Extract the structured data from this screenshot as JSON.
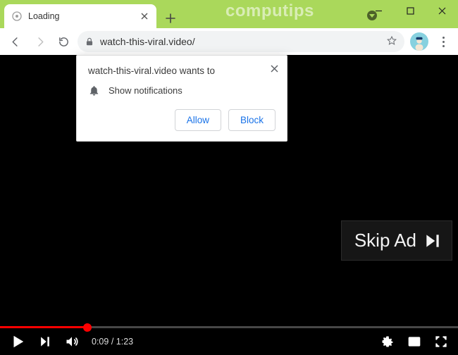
{
  "window": {
    "watermark": "computips"
  },
  "tab": {
    "title": "Loading"
  },
  "address": {
    "url": "watch-this-viral.video/"
  },
  "prompt": {
    "title": "watch-this-viral.video wants to",
    "permission": "Show notifications",
    "allow": "Allow",
    "block": "Block"
  },
  "ad": {
    "skip_label": "Skip Ad"
  },
  "player": {
    "elapsed": "0:09",
    "separator": " / ",
    "duration": "1:23",
    "progress_percent": 19
  }
}
